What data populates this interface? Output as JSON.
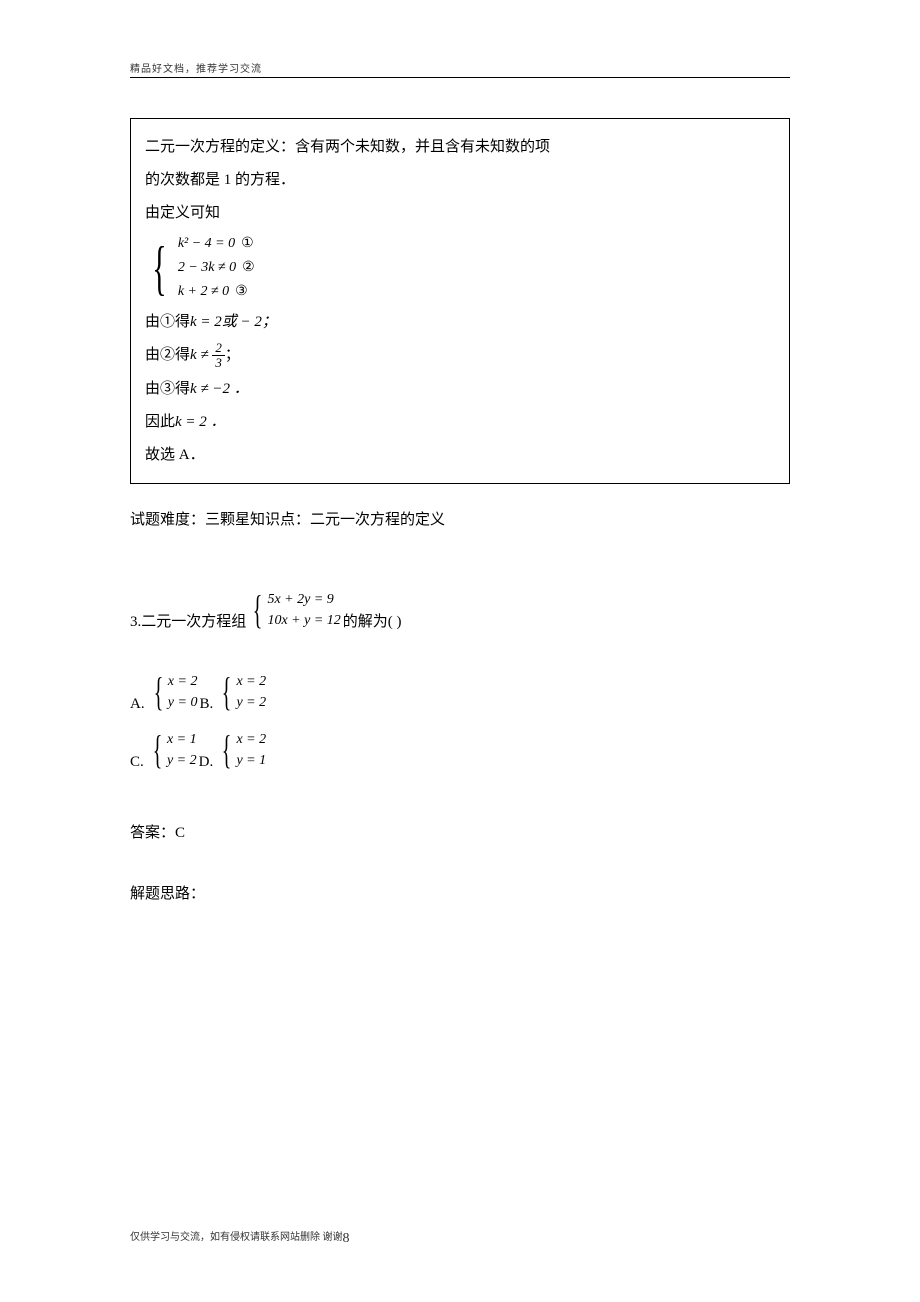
{
  "header": "精品好文档，推荐学习交流",
  "solution": {
    "line1": "二元一次方程的定义：含有两个未知数，并且含有未知数的项",
    "line2": "的次数都是 1 的方程．",
    "line3": "由定义可知",
    "eq1": "k² − 4 = 0",
    "circ1": "①",
    "eq2": "2 − 3k ≠ 0",
    "circ2": "②",
    "eq3": "k + 2 ≠ 0",
    "circ3": "③",
    "line4a": "由①得",
    "line4b": "k = 2或 − 2；",
    "line5a": "由②得",
    "line5b_pre": "k ≠ ",
    "frac_num": "2",
    "frac_den": "3",
    "line5b_post": "；",
    "line6a": "由③得",
    "line6b": "k ≠ −2 ．",
    "line7a": "因此",
    "line7b": "k = 2 ．",
    "line8": "故选 A．"
  },
  "difficulty": "试题难度：三颗星知识点：二元一次方程的定义",
  "question": {
    "num": "3.",
    "prefix": "二元一次方程组",
    "eq1": "5x + 2y = 9",
    "eq2": "10x + y = 12",
    "suffix": " 的解为(    )"
  },
  "options": {
    "A": {
      "label": "A.",
      "eq1": "x = 2",
      "eq2": "y = 0"
    },
    "B": {
      "label": "B.",
      "eq1": "x = 2",
      "eq2": "y = 2"
    },
    "C": {
      "label": "C.",
      "eq1": "x = 1",
      "eq2": "y = 2"
    },
    "D": {
      "label": "D.",
      "eq1": "x = 2",
      "eq2": "y = 1"
    }
  },
  "answer": "答案：C",
  "solution_label": "解题思路：",
  "footer": {
    "text": "仅供学习与交流，如有侵权请联系网站删除 谢谢",
    "pagenum": "8"
  }
}
